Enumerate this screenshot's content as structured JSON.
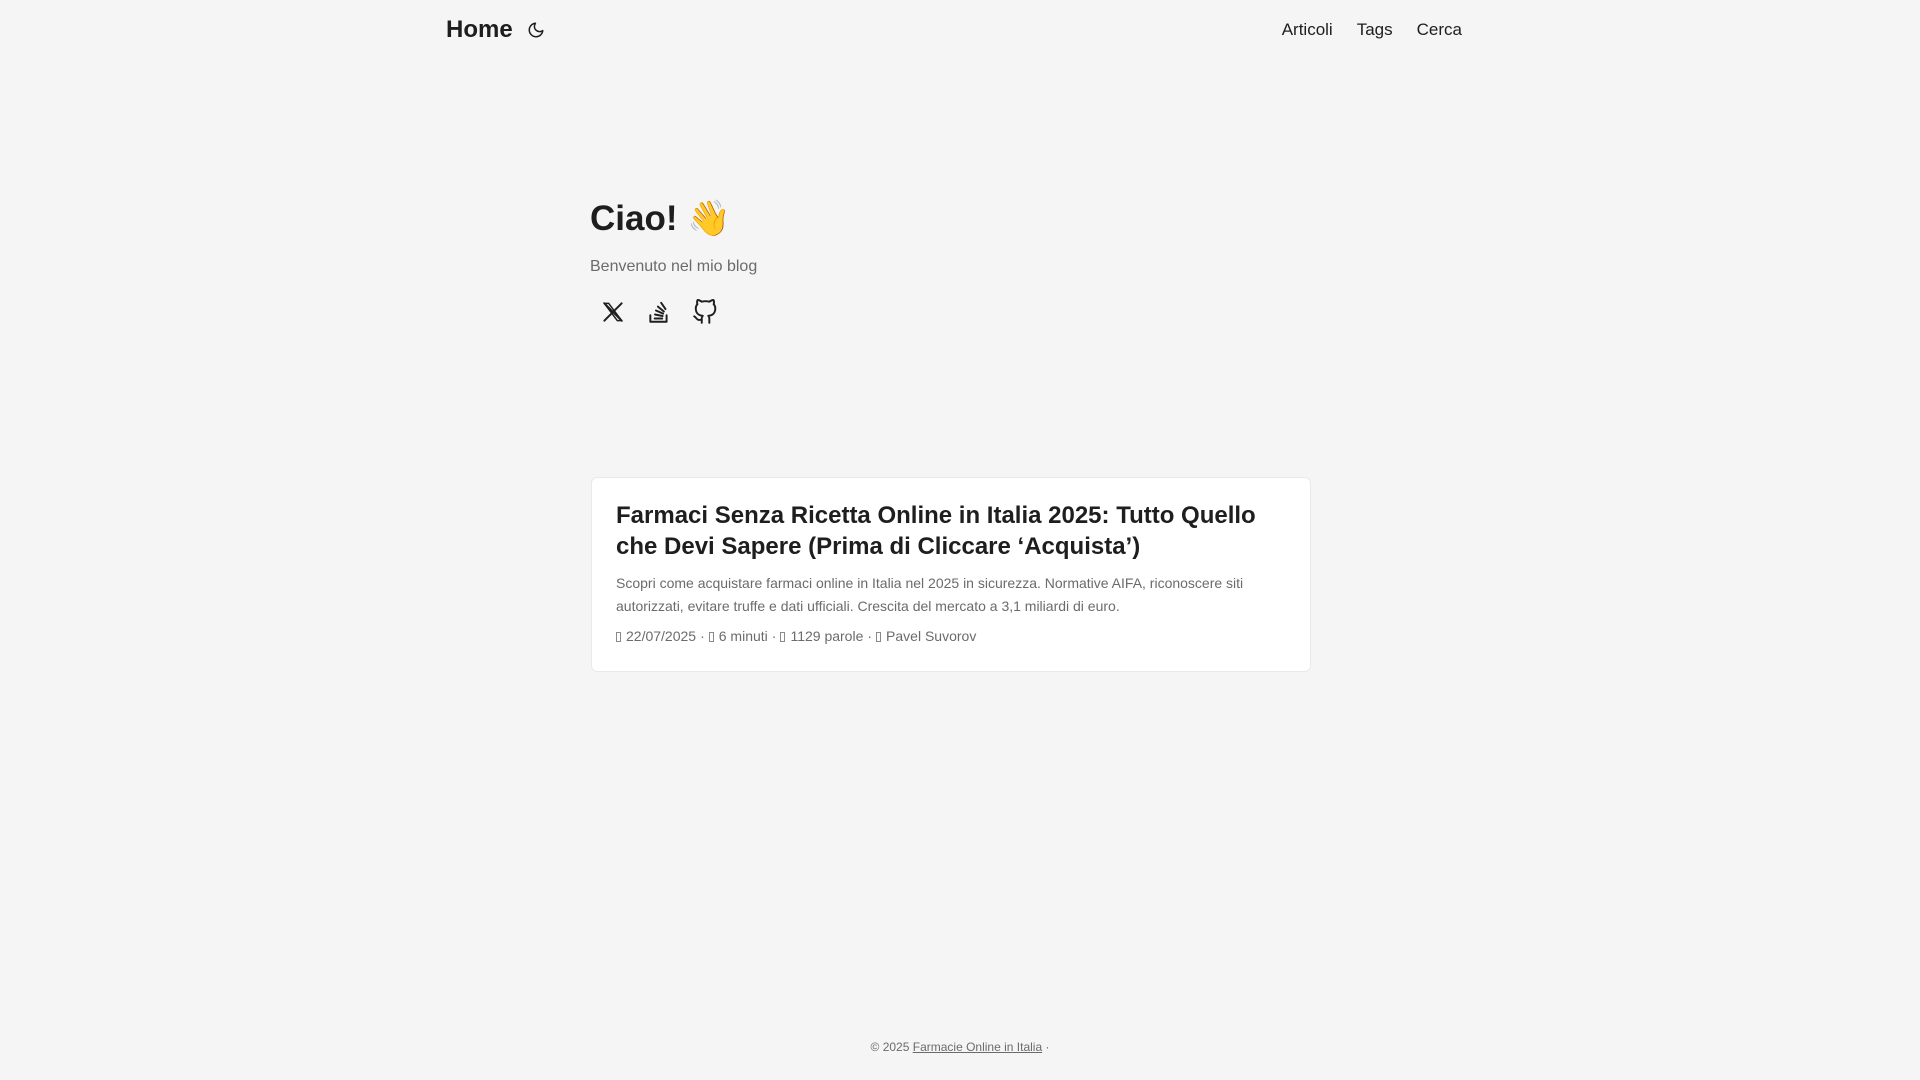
{
  "header": {
    "logo": "Home",
    "theme_toggle_icon": "moon-icon",
    "nav": [
      "Articoli",
      "Tags",
      "Cerca"
    ]
  },
  "hero": {
    "title": "Ciao! 👋",
    "subtitle": "Benvenuto nel mio blog",
    "socials": [
      "x-twitter-icon",
      "stackoverflow-icon",
      "github-icon"
    ]
  },
  "post": {
    "title": "Farmaci Senza Ricetta Online in Italia 2025: Tutto Quello che Devi Sapere (Prima di Cliccare ‘Acquista’)",
    "excerpt": "Scopri come acquistare farmaci online in Italia nel 2025 in sicurezza. Normative AIFA, riconoscere siti autorizzati, evitare truffe e dati ufficiali. Crescita del mercato a 3,1 miliardi di euro.",
    "date": "22/07/2025",
    "reading_time": "6 minuti",
    "words": "1129 parole",
    "author": "Pavel Suvorov",
    "separator": "·"
  },
  "footer": {
    "copyright": "© 2025",
    "link": "Farmacie Online in Italia",
    "trailing": "·"
  },
  "colors": {
    "background": "#f5f5f5",
    "text": "#1e1e1e",
    "secondary": "#6b6b6b",
    "card": "#ffffff"
  }
}
